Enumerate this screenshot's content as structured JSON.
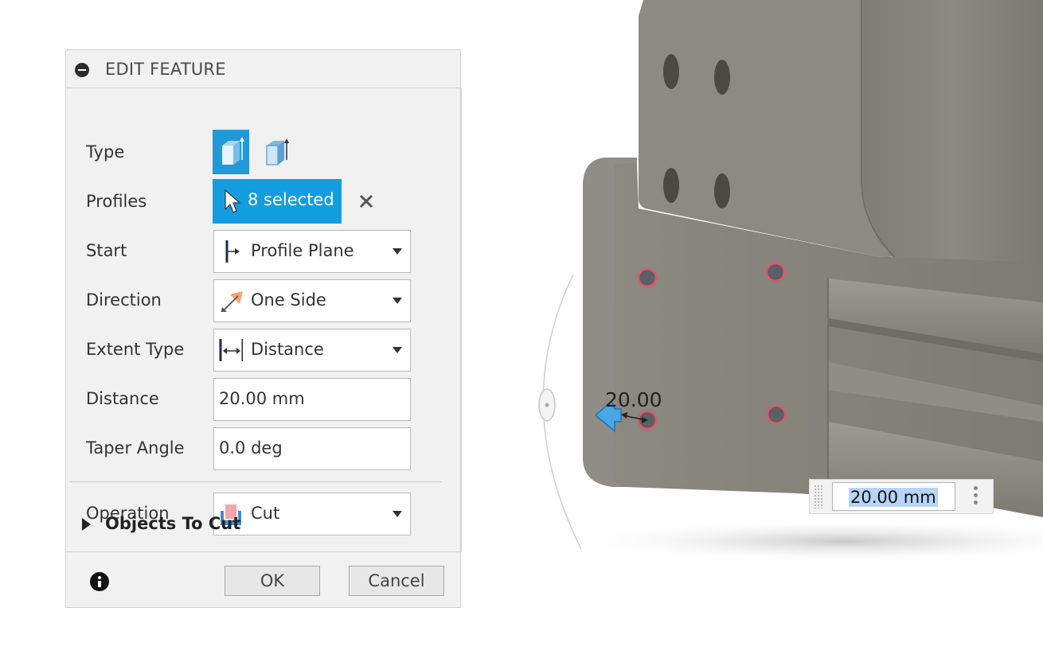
{
  "dialog": {
    "title": "EDIT FEATURE",
    "rows": {
      "type": "Type",
      "profiles": "Profiles",
      "start": "Start",
      "direction": "Direction",
      "extent_type": "Extent Type",
      "distance": "Distance",
      "taper_angle": "Taper Angle",
      "operation": "Operation"
    },
    "profiles_selected": "8 selected",
    "start_value": "Profile Plane",
    "direction_value": "One Side",
    "extent_type_value": "Distance",
    "distance_value": "20.00 mm",
    "taper_angle_value": "0.0 deg",
    "operation_value": "Cut",
    "objects_to_cut": "Objects To Cut",
    "ok_label": "OK",
    "cancel_label": "Cancel"
  },
  "viewport": {
    "dimension_label": "20.00",
    "input_value": "20.00 mm"
  },
  "colors": {
    "accent": "#139ddf",
    "dialog_bg": "#f1f1f1",
    "model_gray": "#8e8c84",
    "selection_red": "#e0566a"
  },
  "icons": [
    "collapse-icon",
    "extrude-icon",
    "thin-extrude-icon",
    "cursor-icon",
    "close-icon",
    "profile-plane-icon",
    "one-side-icon",
    "distance-icon",
    "cut-icon",
    "info-icon",
    "drag-arrow-icon",
    "kebab-icon"
  ]
}
